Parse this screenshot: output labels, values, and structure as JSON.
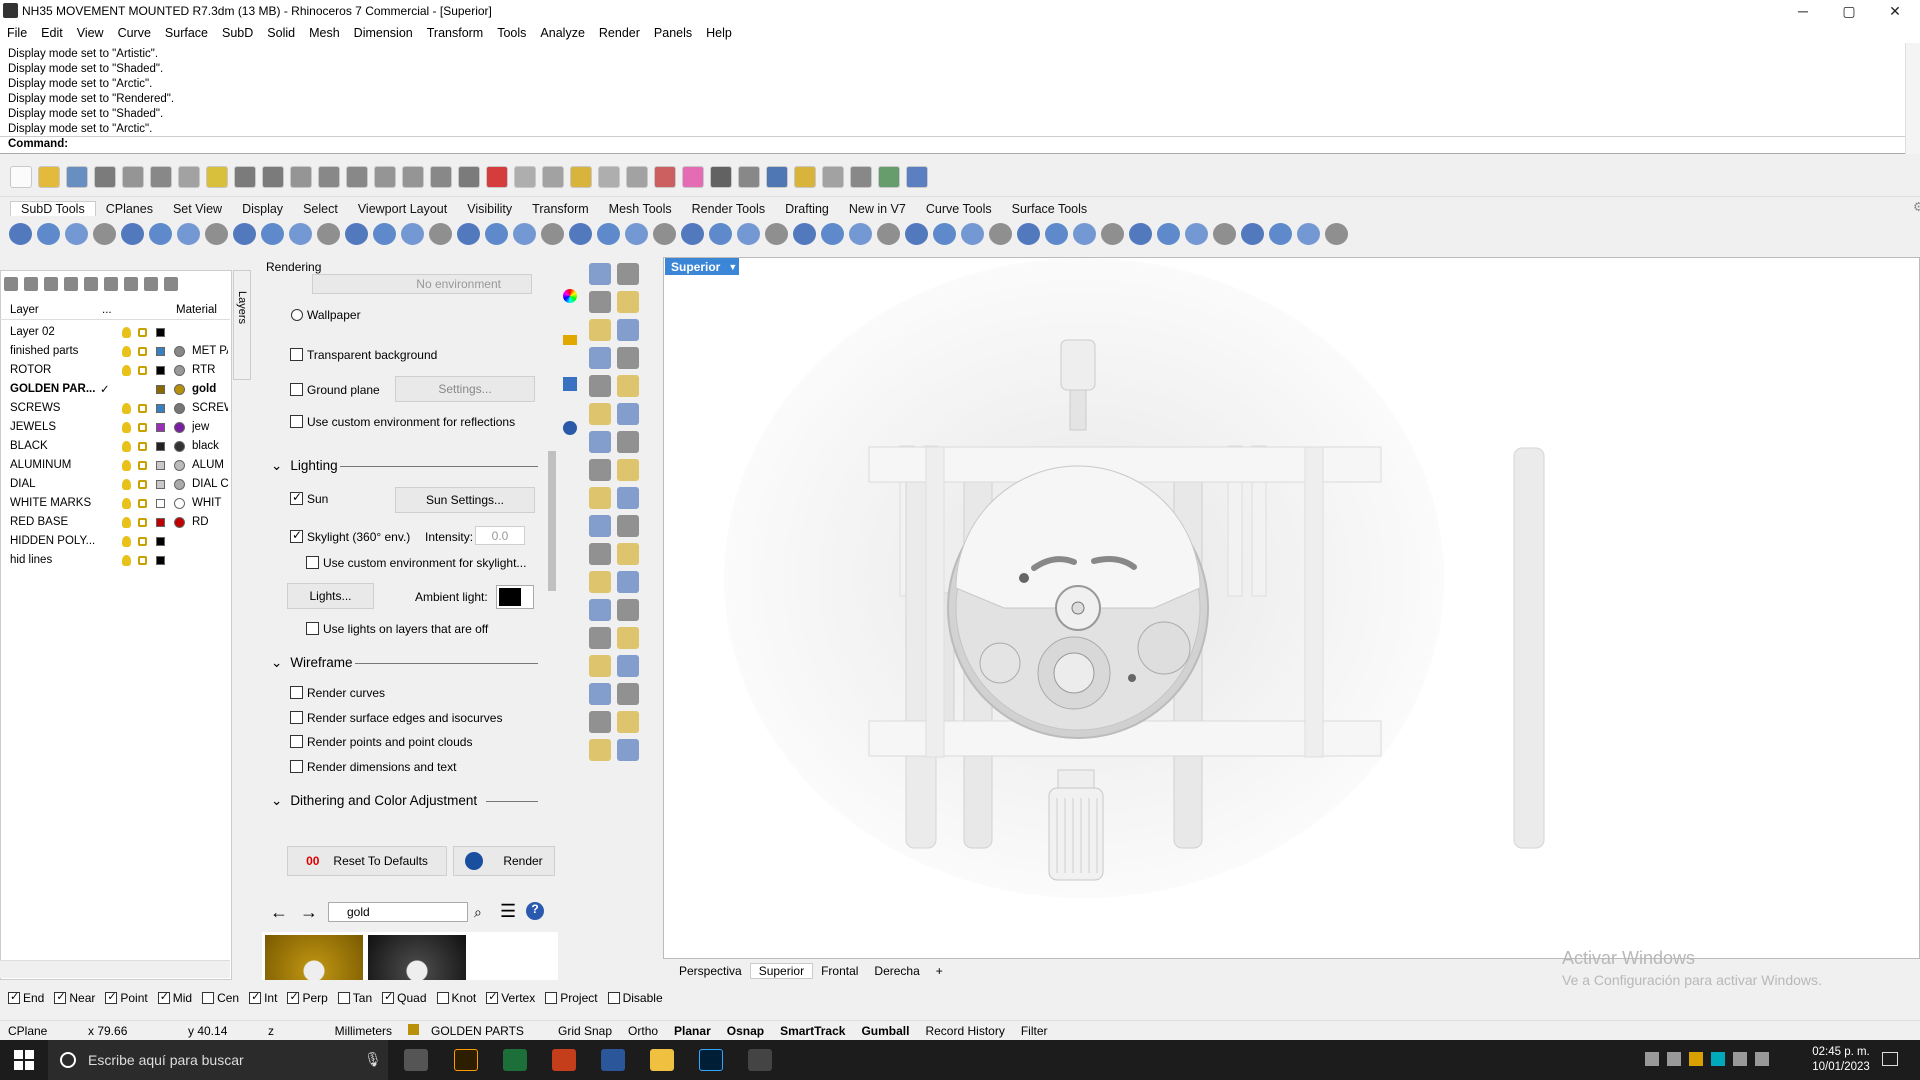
{
  "window": {
    "title": "NH35 MOVEMENT MOUNTED R7.3dm (13 MB) - Rhinoceros 7 Commercial - [Superior]",
    "minimize": "─",
    "maximize": "▢",
    "close": "✕"
  },
  "menu": [
    "File",
    "Edit",
    "View",
    "Curve",
    "Surface",
    "SubD",
    "Solid",
    "Mesh",
    "Dimension",
    "Transform",
    "Tools",
    "Analyze",
    "Render",
    "Panels",
    "Help"
  ],
  "history": [
    "Display mode set to \"Artistic\".",
    "Display mode set to \"Shaded\".",
    "Display mode set to \"Arctic\".",
    "Display mode set to \"Rendered\".",
    "Display mode set to \"Shaded\".",
    "Display mode set to \"Arctic\"."
  ],
  "command": {
    "label": "Command:",
    "value": ""
  },
  "tabs": [
    "SubD Tools",
    "CPlanes",
    "Set View",
    "Display",
    "Select",
    "Viewport Layout",
    "Visibility",
    "Transform",
    "Mesh Tools",
    "Render Tools",
    "Drafting",
    "New in V7",
    "Curve Tools",
    "Surface Tools"
  ],
  "layers": {
    "header": {
      "name": "Layer",
      "dots": "...",
      "material": "Material"
    },
    "tab": "Layers",
    "rows": [
      {
        "name": "Layer 02",
        "color": "#000000",
        "mat": "",
        "matcolor": ""
      },
      {
        "name": "finished parts",
        "color": "#3a7fc0",
        "mat": "MET PA",
        "matcolor": "#888888"
      },
      {
        "name": "ROTOR",
        "color": "#000000",
        "mat": "RTR",
        "matcolor": "#999999"
      },
      {
        "name": "GOLDEN PAR...",
        "check": "✓",
        "color": "#8a6a00",
        "mat": "gold",
        "matcolor": "#b8900a"
      },
      {
        "name": "SCREWS",
        "color": "#3a7fc0",
        "mat": "SCREW",
        "matcolor": "#777777"
      },
      {
        "name": "JEWELS",
        "color": "#9b30b8",
        "mat": "jew",
        "matcolor": "#7a1fa0"
      },
      {
        "name": "BLACK",
        "color": "#222222",
        "mat": "black",
        "matcolor": "#333333"
      },
      {
        "name": "ALUMINUM",
        "color": "#c8c8c8",
        "mat": "ALUM",
        "matcolor": "#bbbbbb"
      },
      {
        "name": "DIAL",
        "color": "#c8c8c8",
        "mat": "DIAL C",
        "matcolor": "#aaaaaa"
      },
      {
        "name": "WHITE MARKS",
        "color": "#ffffff",
        "mat": "WHIT",
        "matcolor": "#ffffff"
      },
      {
        "name": "RED BASE",
        "color": "#c00000",
        "mat": "RD",
        "matcolor": "#c00000"
      },
      {
        "name": "HIDDEN POLY...",
        "color": "#000000",
        "mat": "",
        "matcolor": ""
      },
      {
        "name": "hid lines",
        "color": "#000000",
        "mat": "",
        "matcolor": ""
      }
    ]
  },
  "render": {
    "title": "Rendering",
    "no_env": "No environment",
    "wallpaper": "Wallpaper",
    "transparent": "Transparent background",
    "ground": "Ground plane",
    "settings": "Settings...",
    "custom_env": "Use custom environment for reflections",
    "lighting": "Lighting",
    "sun": "Sun",
    "sun_settings": "Sun Settings...",
    "skylight": "Skylight (360° env.)",
    "intensity_label": "Intensity:",
    "intensity": "0.0",
    "custom_sky": "Use custom environment for skylight...",
    "lights": "Lights...",
    "ambient": "Ambient light:",
    "use_lights_off": "Use lights on layers that are off",
    "wireframe": "Wireframe",
    "render_curves": "Render curves",
    "render_edges": "Render surface edges and isocurves",
    "render_points": "Render points and point clouds",
    "render_dims": "Render dimensions and text",
    "dither": "Dithering and Color Adjustment",
    "reset": "Reset To Defaults",
    "render_btn": "Render"
  },
  "materials": {
    "search": "gold"
  },
  "viewport": {
    "label": "Superior",
    "tabs": [
      "Perspectiva",
      "Superior",
      "Frontal",
      "Derecha"
    ],
    "active": "Superior"
  },
  "watermark": {
    "line1": "Activar Windows",
    "line2": "Ve a Configuración para activar Windows."
  },
  "osnap": [
    {
      "l": "End",
      "on": true
    },
    {
      "l": "Near",
      "on": true
    },
    {
      "l": "Point",
      "on": true
    },
    {
      "l": "Mid",
      "on": true
    },
    {
      "l": "Cen",
      "on": false
    },
    {
      "l": "Int",
      "on": true
    },
    {
      "l": "Perp",
      "on": true
    },
    {
      "l": "Tan",
      "on": false
    },
    {
      "l": "Quad",
      "on": true
    },
    {
      "l": "Knot",
      "on": false
    },
    {
      "l": "Vertex",
      "on": true
    },
    {
      "l": "Project",
      "on": false
    },
    {
      "l": "Disable",
      "on": false
    }
  ],
  "status": {
    "cplane": "CPlane",
    "x": "x 79.66",
    "y": "y 40.14",
    "z": "z",
    "units": "Millimeters",
    "layer": "GOLDEN PARTS",
    "items": [
      "Grid Snap",
      "Ortho",
      "Planar",
      "Osnap",
      "SmartTrack",
      "Gumball",
      "Record History",
      "Filter"
    ],
    "bold": [
      "Planar",
      "Osnap",
      "SmartTrack",
      "Gumball"
    ]
  },
  "taskbar": {
    "search": "Escribe aquí para buscar",
    "time": "02:45 p. m.",
    "date": "10/01/2023"
  }
}
